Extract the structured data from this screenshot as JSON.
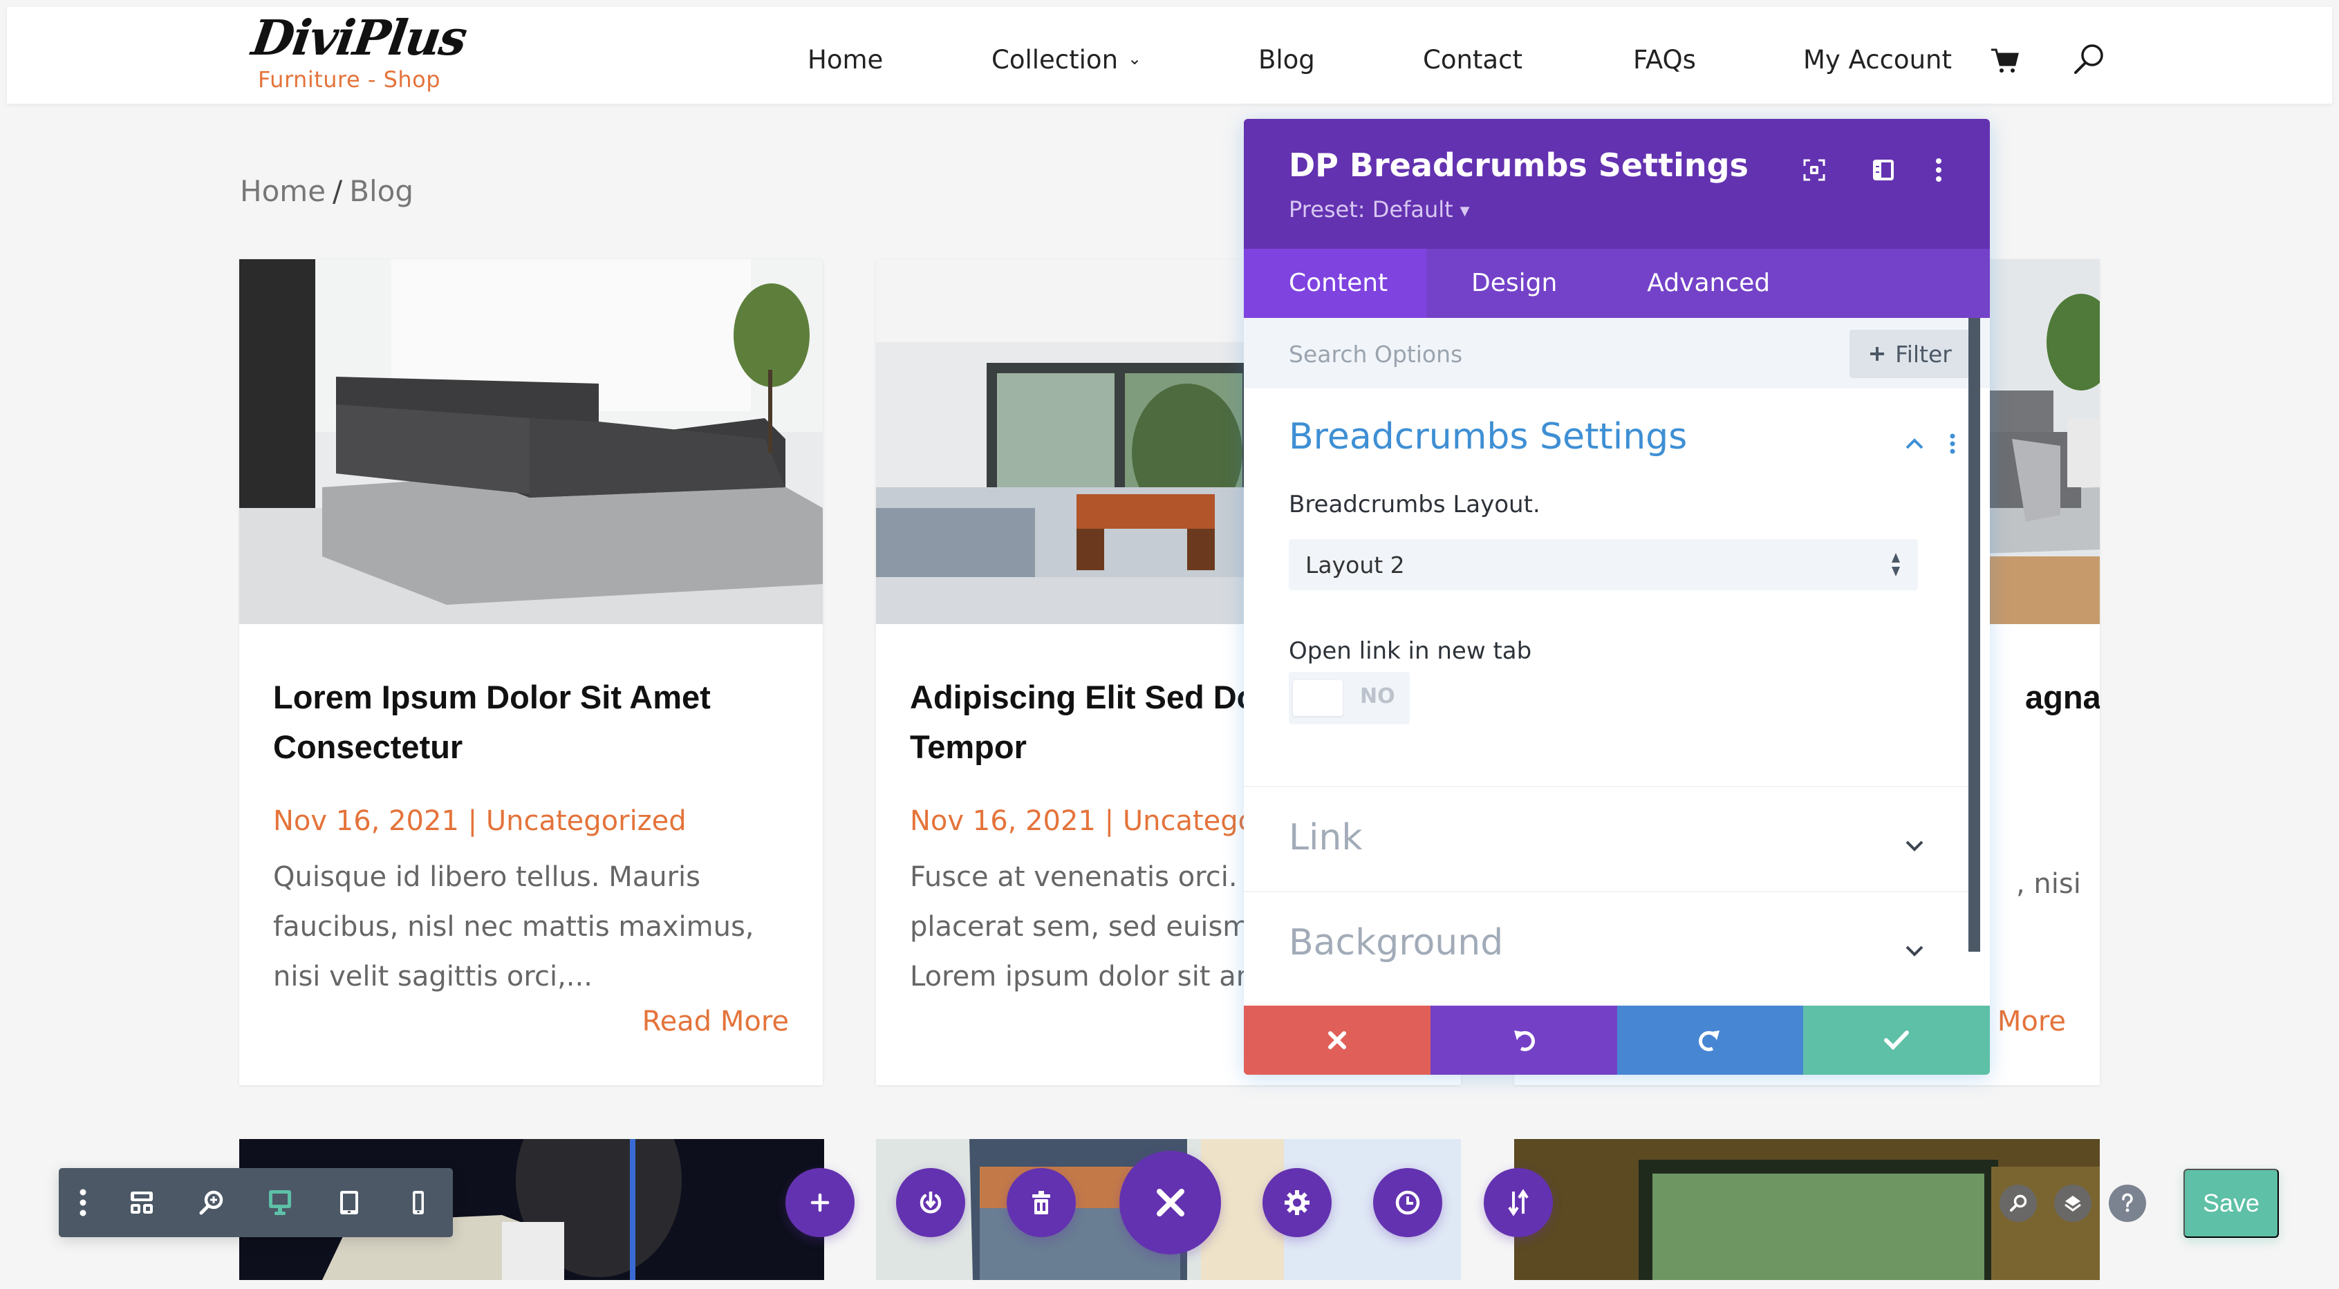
{
  "site": {
    "logo_main": "DiviPlus",
    "logo_sub": "Furniture - Shop",
    "nav": [
      {
        "label": "Home"
      },
      {
        "label": "Collection",
        "has_dropdown": true
      },
      {
        "label": "Blog"
      },
      {
        "label": "Contact"
      },
      {
        "label": "FAQs"
      },
      {
        "label": "My Account"
      }
    ],
    "nav_icons": [
      "cart-icon",
      "search-icon"
    ]
  },
  "breadcrumb": {
    "items": [
      "Home",
      "Blog"
    ],
    "separator": "/"
  },
  "posts": [
    {
      "title": "Lorem Ipsum Dolor Sit Amet Consectetur",
      "date": "Nov 16, 2021",
      "separator": "|",
      "category": "Uncategorized",
      "excerpt": "Quisque id libero tellus. Mauris faucibus, nisl nec mattis maximus, nisi velit sagittis orci,...",
      "read_more": "Read More"
    },
    {
      "title": "Adipiscing Elit Sed Do E",
      "title_line2": "Tempor",
      "date": "Nov 16, 2021",
      "separator": "|",
      "category": "Uncategor",
      "excerpt": "Fusce at venenatis orci. U placerat sem, sed euismo Lorem ipsum dolor sit am",
      "read_more": ""
    },
    {
      "title_fragment": "agna",
      "excerpt_fragment": ", nisi",
      "read_more_fragment": "More"
    }
  ],
  "settings_panel": {
    "title": "DP Breadcrumbs Settings",
    "preset": "Preset: Default",
    "tabs": [
      {
        "label": "Content",
        "active": true
      },
      {
        "label": "Design",
        "active": false
      },
      {
        "label": "Advanced",
        "active": false
      }
    ],
    "search_placeholder": "Search Options",
    "filter_label": "Filter",
    "sections": [
      {
        "title": "Breadcrumbs Settings",
        "open": true,
        "fields": {
          "layout_label": "Breadcrumbs Layout.",
          "layout_value": "Layout 2",
          "new_tab_label": "Open link in new tab",
          "new_tab_value": "NO"
        }
      },
      {
        "title": "Link",
        "open": false
      },
      {
        "title": "Background",
        "open": false
      }
    ],
    "footer_buttons": [
      {
        "name": "discard",
        "icon": "close-icon",
        "color": "#e06059"
      },
      {
        "name": "undo",
        "icon": "undo-icon",
        "color": "#7441c6"
      },
      {
        "name": "redo",
        "icon": "redo-icon",
        "color": "#4786d3"
      },
      {
        "name": "save",
        "icon": "check-icon",
        "color": "#5ec0a6"
      }
    ]
  },
  "builder_toolbar": {
    "icons": [
      "more-icon",
      "wireframe-icon",
      "zoom-icon",
      "desktop-icon",
      "tablet-icon",
      "phone-icon"
    ],
    "active_view": "desktop-icon"
  },
  "floating_actions": [
    "add-icon",
    "power-icon",
    "trash-icon",
    "close-icon",
    "gear-icon",
    "history-icon",
    "sort-icon"
  ],
  "right_controls": [
    "search-icon",
    "layers-icon",
    "help-icon"
  ],
  "save_label": "Save",
  "colors": {
    "accent_orange": "#e4733a",
    "builder_purple": "#6332b0",
    "tab_purple": "#7442c8",
    "section_blue": "#3e8fd4",
    "save_green": "#5ec0a6",
    "toolbar_grey": "#4c5866"
  }
}
